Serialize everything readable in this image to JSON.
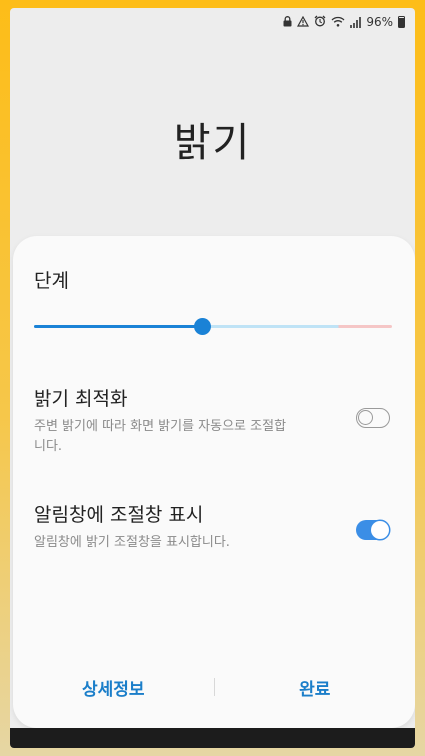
{
  "status_bar": {
    "icons": [
      "lock-icon",
      "sync-warning-icon",
      "alarm-icon",
      "wifi-icon",
      "signal-icon",
      "battery-icon"
    ],
    "battery_text": "96%"
  },
  "title": "밝기",
  "level": {
    "label": "단계",
    "value_fraction": 0.47,
    "accent_color": "#1a82d6"
  },
  "settings": [
    {
      "name": "밝기 최적화",
      "description": "주변 밝기에 따라 화면 밝기를 자동으로 조절합니다.",
      "enabled": false
    },
    {
      "name": "알림창에 조절창 표시",
      "description": "알림창에 밝기 조절창을 표시합니다.",
      "enabled": true
    }
  ],
  "buttons": {
    "details": "상세정보",
    "done": "완료"
  }
}
